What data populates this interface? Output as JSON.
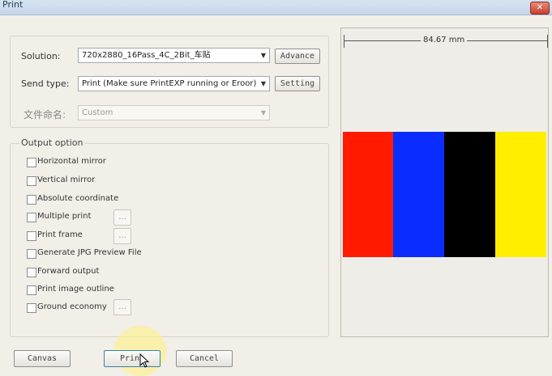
{
  "window": {
    "title": "Print",
    "close_glyph": "✕"
  },
  "form": {
    "solution_label": "Solution:",
    "solution_value": "720x2880_16Pass_4C_2Bit_车贴",
    "advance_label": "Advance",
    "send_type_label": "Send type:",
    "send_type_value": "Print (Make sure PrintEXP running or Eroor)",
    "setting_label": "Setting",
    "file_naming_label": "文件命名:",
    "file_naming_value": "Custom"
  },
  "output_option": {
    "title": "Output option",
    "items": [
      {
        "label": "Horizontal mirror",
        "checked": false
      },
      {
        "label": "Vertical mirror",
        "checked": false
      },
      {
        "label": "Absolute coordinate",
        "checked": false
      },
      {
        "label": "Multiple print",
        "checked": false
      },
      {
        "label": "Print frame",
        "checked": false
      },
      {
        "label": "Generate JPG Preview File",
        "checked": false
      },
      {
        "label": "Forward output",
        "checked": false
      },
      {
        "label": "Print image outline",
        "checked": false
      },
      {
        "label": "Ground economy",
        "checked": false
      }
    ],
    "ellipsis": "..."
  },
  "preview": {
    "width_text": "84.67 mm",
    "colors": [
      "#ff1a00",
      "#0a2cff",
      "#000000",
      "#ffee00"
    ]
  },
  "footer": {
    "canvas_label": "Canvas",
    "print_label": "Print",
    "cancel_label": "Cancel"
  }
}
